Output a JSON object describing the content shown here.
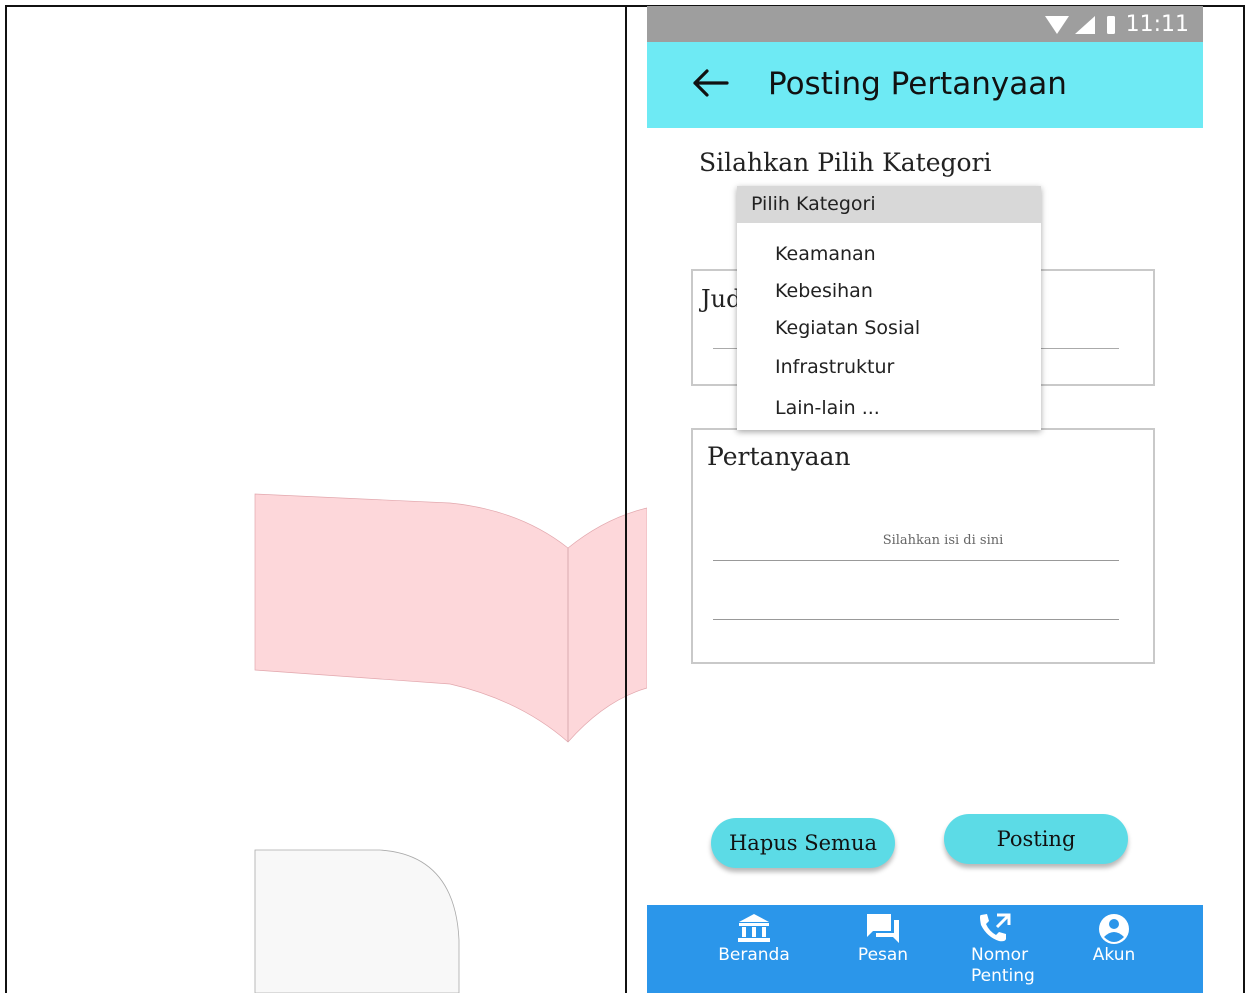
{
  "status_bar": {
    "time": "11:11"
  },
  "app_bar": {
    "title": "Posting Pertanyaan"
  },
  "form": {
    "category_prompt": "Silahkan Pilih Kategori",
    "judul_label": "Jud",
    "pertanyaan_label": "Pertanyaan",
    "pertanyaan_placeholder": "Silahkan isi di sini"
  },
  "dropdown": {
    "header": "Pilih Kategori",
    "options": [
      "Keamanan",
      "Kebesihan",
      "Kegiatan Sosial",
      "Infrastruktur",
      "Lain-lain ..."
    ]
  },
  "buttons": {
    "clear": "Hapus Semua",
    "post": "Posting"
  },
  "bottom_nav": {
    "items": [
      {
        "label": "Beranda",
        "icon": "bank-icon"
      },
      {
        "label": "Pesan",
        "icon": "chat-icon"
      },
      {
        "label": "Nomor Penting",
        "icon": "phone-icon"
      },
      {
        "label": "Akun",
        "icon": "account-icon"
      }
    ]
  },
  "colors": {
    "app_bar": "#6eeaf4",
    "button": "#5cdbe6",
    "nav_bar": "#2b96ea",
    "status_bar": "#9e9e9e"
  }
}
